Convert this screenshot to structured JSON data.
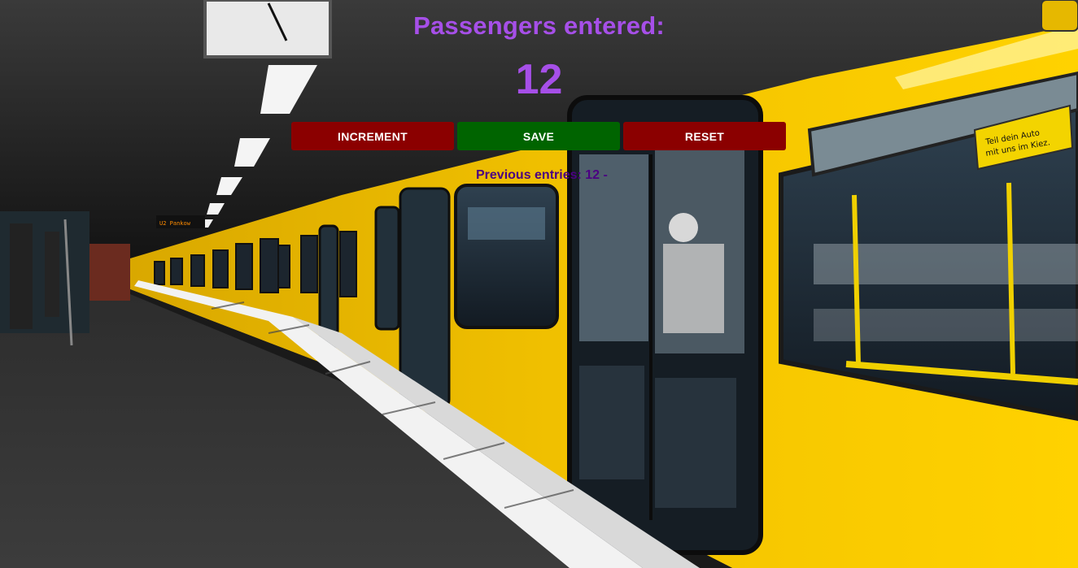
{
  "counter": {
    "title": "Passengers entered:",
    "value": "12"
  },
  "buttons": {
    "increment_label": "INCREMENT",
    "save_label": "SAVE",
    "reset_label": "RESET"
  },
  "entries": {
    "label": "Previous entries:",
    "value": "12 -"
  },
  "colors": {
    "accent_purple": "#a64fe8",
    "entries_text": "#4b0082",
    "increment_bg": "#8b0000",
    "save_bg": "#006400",
    "reset_bg": "#8b0000",
    "train_yellow": "#f5c400"
  },
  "background": {
    "icon": "subway-platform-photo",
    "sign_text": "Teil dein Auto mit uns im Kiez."
  }
}
